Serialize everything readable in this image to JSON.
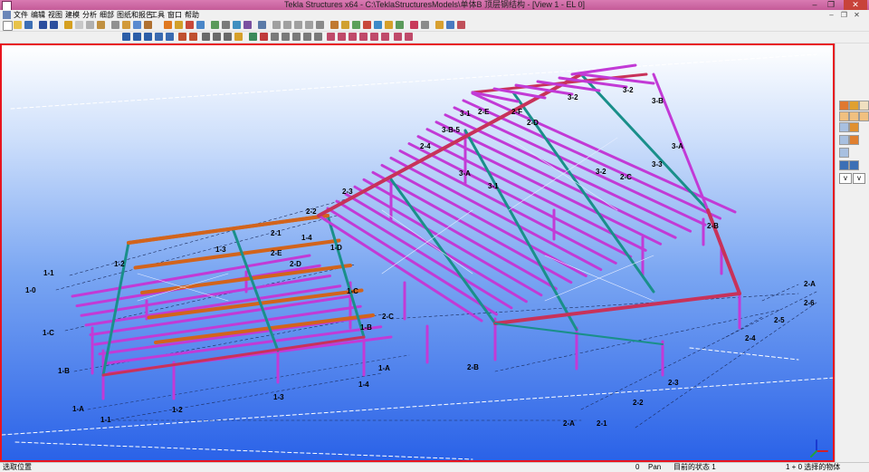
{
  "window": {
    "title": "Tekla Structures x64 - C:\\TeklaStructuresModels\\单体B 顶层钢结构 - [View 1 - EL 0]"
  },
  "menu": {
    "items": [
      "文件",
      "编辑",
      "视图",
      "建模",
      "分析",
      "细部",
      "图纸和报告",
      "工具",
      "窗口",
      "帮助"
    ]
  },
  "window_controls": {
    "minimize": "–",
    "restore": "❐",
    "close": "✕",
    "mdi_minimize": "–",
    "mdi_restore": "❐",
    "mdi_close": "✕"
  },
  "model_labels": [
    "3-2",
    "3-2",
    "3-B",
    "3-1",
    "2-E",
    "2-F",
    "2-D",
    "3-B-5",
    "2-4",
    "3-A",
    "3-3",
    "3-1",
    "2-C",
    "3-2",
    "3-A",
    "2-3",
    "2-2",
    "2-B",
    "2-1",
    "1-4",
    "1-D",
    "1-3",
    "2-E",
    "2-D",
    "1-2",
    "1-1",
    "1-0",
    "1-C",
    "2-C",
    "1-B",
    "1-C",
    "1-B",
    "1-A",
    "1-4",
    "2-B",
    "2-A",
    "2-6",
    "2-5",
    "2-4",
    "2-3",
    "1-3",
    "2-2",
    "1-2",
    "1-A",
    "1-1",
    "2-A",
    "2-1"
  ],
  "side_panel": {
    "dropdown1": "v",
    "dropdown2": "v"
  },
  "statusbar": {
    "left": "选取位置",
    "count": "0",
    "mode": "Pan",
    "state": "目前的状态 1",
    "selection": "1 + 0 选择的物体"
  },
  "colors": {
    "title_bar": "#c45b98",
    "viewport_border": "#e8141e",
    "beam_magenta": "#c23ad6",
    "beam_orange": "#d2641c",
    "beam_teal": "#1a8f8a",
    "beam_red": "#c8325a"
  }
}
